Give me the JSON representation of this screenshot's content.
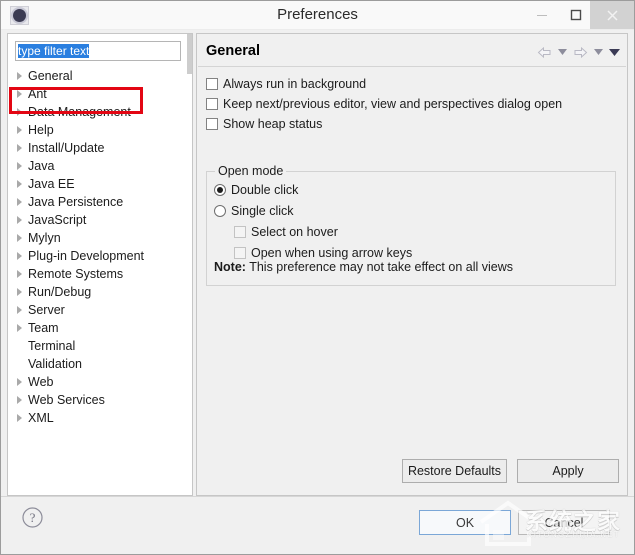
{
  "window": {
    "title": "Preferences",
    "app_icon": "eclipse-icon",
    "controls": {
      "minimize": "minimize-icon",
      "maximize": "maximize-icon",
      "close": "close-icon"
    }
  },
  "sidebar": {
    "filter": {
      "value": "type filter text",
      "placeholder": "type filter text",
      "selected": true
    },
    "items": [
      {
        "label": "General",
        "expandable": true,
        "selected": true,
        "annotated": true
      },
      {
        "label": "Ant",
        "expandable": true
      },
      {
        "label": "Data Management",
        "expandable": true
      },
      {
        "label": "Help",
        "expandable": true
      },
      {
        "label": "Install/Update",
        "expandable": true
      },
      {
        "label": "Java",
        "expandable": true
      },
      {
        "label": "Java EE",
        "expandable": true
      },
      {
        "label": "Java Persistence",
        "expandable": true
      },
      {
        "label": "JavaScript",
        "expandable": true
      },
      {
        "label": "Mylyn",
        "expandable": true
      },
      {
        "label": "Plug-in Development",
        "expandable": true
      },
      {
        "label": "Remote Systems",
        "expandable": true
      },
      {
        "label": "Run/Debug",
        "expandable": true
      },
      {
        "label": "Server",
        "expandable": true
      },
      {
        "label": "Team",
        "expandable": true
      },
      {
        "label": "Terminal",
        "expandable": false
      },
      {
        "label": "Validation",
        "expandable": false
      },
      {
        "label": "Web",
        "expandable": true
      },
      {
        "label": "Web Services",
        "expandable": true
      },
      {
        "label": "XML",
        "expandable": true
      }
    ]
  },
  "content": {
    "page_title": "General",
    "nav": {
      "back": "back-arrow-icon",
      "back_menu": "chevron-down-icon",
      "forward": "forward-arrow-icon",
      "forward_menu": "chevron-down-icon",
      "view_menu": "chevron-down-icon"
    },
    "checkboxes": [
      {
        "label": "Always run in background",
        "checked": false,
        "enabled": true
      },
      {
        "label": "Keep next/previous editor, view and perspectives dialog open",
        "checked": false,
        "enabled": true
      },
      {
        "label": "Show heap status",
        "checked": false,
        "enabled": true
      }
    ],
    "open_mode": {
      "legend": "Open mode",
      "options": [
        {
          "label": "Double click",
          "selected": true
        },
        {
          "label": "Single click",
          "selected": false
        }
      ],
      "sub_checkboxes": [
        {
          "label": "Select on hover",
          "checked": false,
          "enabled": false
        },
        {
          "label": "Open when using arrow keys",
          "checked": false,
          "enabled": false
        }
      ],
      "note_prefix": "Note:",
      "note_text": "This preference may not take effect on all views"
    },
    "buttons": {
      "restore_defaults": "Restore Defaults",
      "apply": "Apply"
    }
  },
  "footer": {
    "help": "help-icon",
    "ok": "OK",
    "cancel": "Cancel"
  },
  "watermark": {
    "chinese": "系统之家",
    "english": "XITONGZHIJIA.NET",
    "logo": "house-icon"
  },
  "colors": {
    "annotation": "#e30613",
    "selection": "#2a7fe0",
    "panel_bg": "#f0f0f0",
    "titlebar_bg": "#f9f9f9",
    "close_bg": "#d2d2d2"
  }
}
